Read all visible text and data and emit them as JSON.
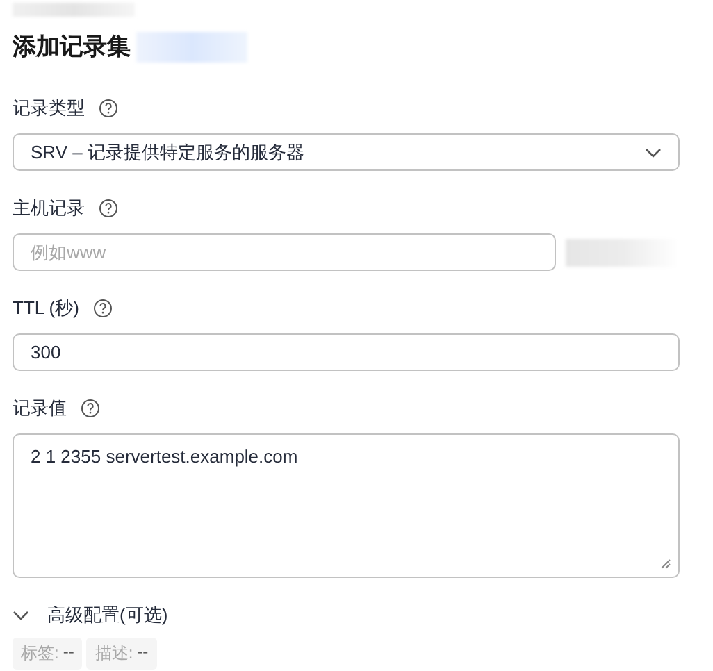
{
  "title": "添加记录集",
  "fields": [
    {
      "kind": "select",
      "label": "记录类型",
      "value": "SRV – 记录提供特定服务的服务器"
    },
    {
      "kind": "input",
      "label": "主机记录",
      "placeholder": "例如www",
      "suffix_redacted": true
    },
    {
      "kind": "input",
      "label": "TTL (秒)",
      "value": "300"
    },
    {
      "kind": "textarea",
      "label": "记录值",
      "value": "2 1 2355 servertest.example.com"
    }
  ],
  "advanced": {
    "label": "高级配置(可选)",
    "expanded": false,
    "summary": [
      {
        "label": "标签:",
        "value": "--"
      },
      {
        "label": "描述:",
        "value": "--"
      }
    ]
  }
}
